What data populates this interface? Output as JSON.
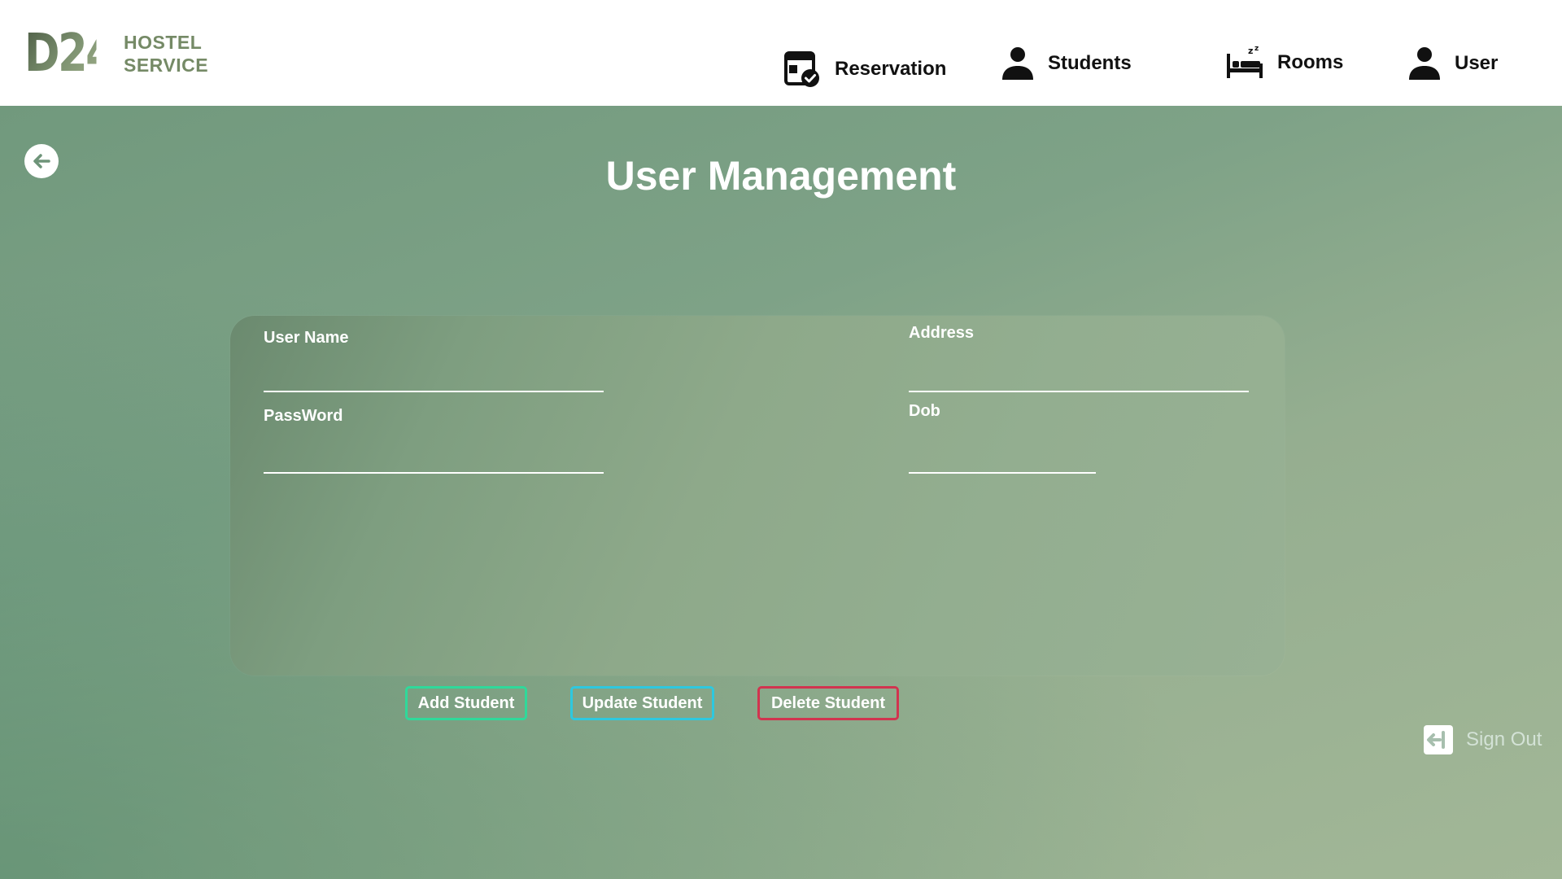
{
  "brand": {
    "logo_mark": "D24",
    "line1": "HOSTEL",
    "line2": "SERVICE"
  },
  "nav": {
    "items": [
      {
        "label": "Reservation",
        "icon": "reservation-calendar-icon"
      },
      {
        "label": "Students",
        "icon": "person-icon"
      },
      {
        "label": "Rooms",
        "icon": "bed-icon"
      },
      {
        "label": "User",
        "icon": "person-icon"
      }
    ]
  },
  "page": {
    "title": "User Management",
    "back_icon": "arrow-left-icon"
  },
  "form": {
    "username": {
      "label": "User Name",
      "value": ""
    },
    "password": {
      "label": "PassWord",
      "value": ""
    },
    "address": {
      "label": "Address",
      "value": ""
    },
    "dob": {
      "label": "Dob",
      "value": ""
    }
  },
  "actions": {
    "add": {
      "label": "Add Student",
      "color": "#2fd99a"
    },
    "update": {
      "label": "Update Student",
      "color": "#2ec8df"
    },
    "delete": {
      "label": "Delete Student",
      "color": "#d1344f"
    }
  },
  "footer": {
    "sign_out_label": "Sign Out",
    "sign_out_icon": "sign-out-icon"
  }
}
